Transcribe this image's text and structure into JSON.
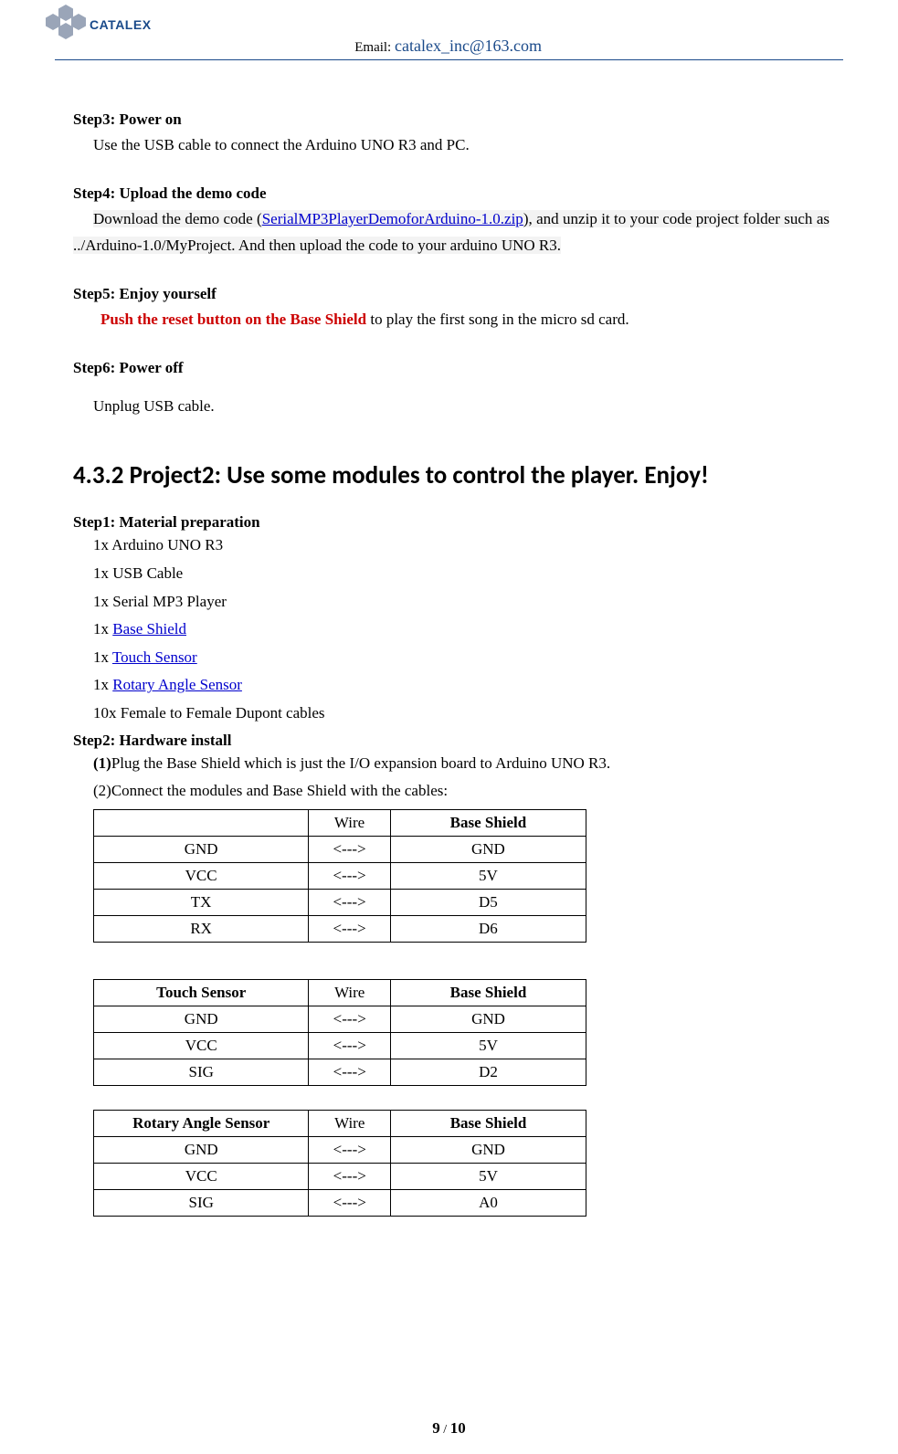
{
  "header": {
    "brand": "CATALEX",
    "emailLabel": "Email: ",
    "emailAddr": "catalex_inc@163.com"
  },
  "step3": {
    "title": "Step3: Power on",
    "body": "Use the USB cable to connect the Arduino UNO R3 and PC."
  },
  "step4": {
    "title": "Step4: Upload the demo code",
    "pre": "Download the demo code (",
    "link": "SerialMP3PlayerDemoforArduino-1.0.zip",
    "post": "), and unzip it to your code project folder such as ../Arduino-1.0/MyProject. And then upload the code to your arduino UNO R3."
  },
  "step5": {
    "title": "Step5: Enjoy yourself",
    "red": "Push the reset button on the Base Shield",
    "rest": " to play the first song in the micro sd card."
  },
  "step6": {
    "title": "Step6: Power off",
    "body": "Unplug USB cable."
  },
  "section": "4.3.2 Project2: Use some modules to control the player. Enjoy!",
  "p2step1": {
    "title": "Step1: Material preparation",
    "m1": "1x Arduino UNO R3",
    "m2": "1x USB Cable",
    "m3": "1x Serial MP3 Player",
    "m4pre": "1x ",
    "m4link": "Base Shield",
    "m5pre": "1x ",
    "m5link": "Touch Sensor",
    "m6pre": "1x ",
    "m6link": "Rotary Angle Sensor",
    "m7": "10x Female to Female Dupont cables"
  },
  "p2step2": {
    "title": "Step2: Hardware install",
    "l1b": "(1)",
    "l1": "Plug the Base Shield which is just the I/O expansion board to Arduino UNO R3.",
    "l2": "(2)Connect the modules and Base Shield with the cables:"
  },
  "table1": {
    "h1": "",
    "h2": "Wire",
    "h3": "Base Shield",
    "rows": [
      [
        "GND",
        "<--->",
        "GND"
      ],
      [
        "VCC",
        "<--->",
        "5V"
      ],
      [
        "TX",
        "<--->",
        "D5"
      ],
      [
        "RX",
        "<--->",
        "D6"
      ]
    ]
  },
  "table2": {
    "h1": "Touch Sensor",
    "h2": "Wire",
    "h3": "Base Shield",
    "rows": [
      [
        "GND",
        "<--->",
        "GND"
      ],
      [
        "VCC",
        "<--->",
        "5V"
      ],
      [
        "SIG",
        "<--->",
        "D2"
      ]
    ]
  },
  "table3": {
    "h1": "Rotary Angle Sensor",
    "h2": "Wire",
    "h3": "Base Shield",
    "rows": [
      [
        "GND",
        "<--->",
        "GND"
      ],
      [
        "VCC",
        "<--->",
        "5V"
      ],
      [
        "SIG",
        "<--->",
        "A0"
      ]
    ]
  },
  "footer": {
    "cur": "9",
    "sep": " / ",
    "tot": "10"
  }
}
